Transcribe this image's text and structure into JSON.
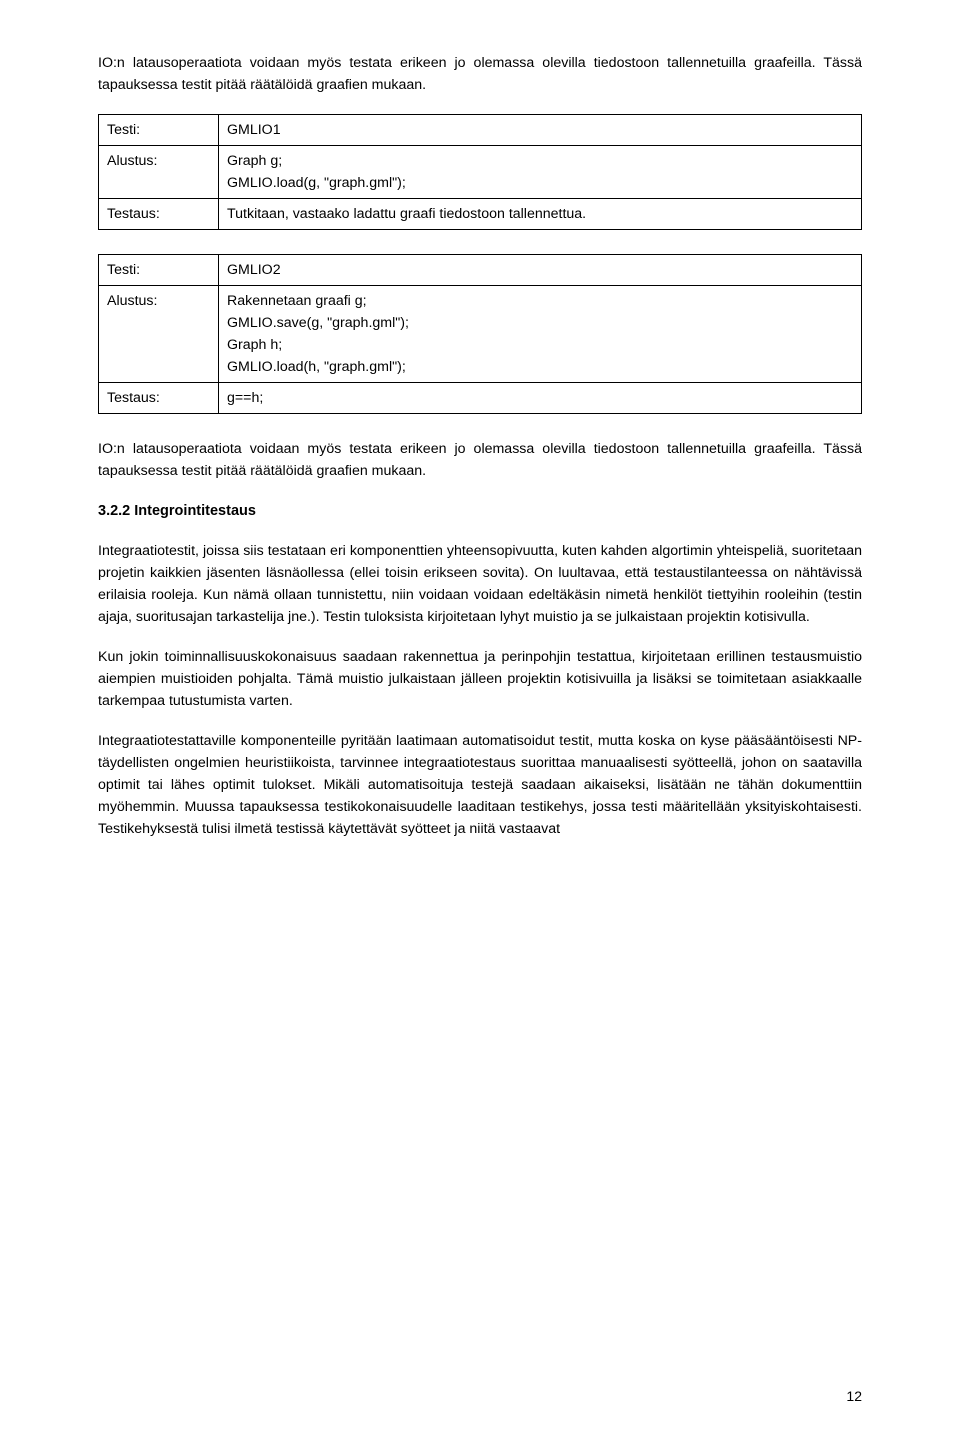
{
  "intro1": "IO:n latausoperaatiota voidaan myös testata erikeen jo olemassa olevilla tiedostoon tallennetuilla graafeilla. Tässä tapauksessa testit pitää räätälöidä graafien mukaan.",
  "table1": {
    "r1": {
      "label": "Testi:",
      "v1": "GMLIO1"
    },
    "r2": {
      "label": "Alustus:",
      "v1": "Graph g;",
      "v2": "GMLIO.load(g, \"graph.gml\");"
    },
    "r3": {
      "label": "Testaus:",
      "v1": "Tutkitaan, vastaako ladattu graafi tiedostoon tallennettua."
    }
  },
  "table2": {
    "r1": {
      "label": "Testi:",
      "v1": "GMLIO2"
    },
    "r2": {
      "label": "Alustus:",
      "v1": "Rakennetaan graafi g;",
      "v2": "GMLIO.save(g, \"graph.gml\");",
      "v3": "Graph h;",
      "v4": "GMLIO.load(h, \"graph.gml\");"
    },
    "r3": {
      "label": "Testaus:",
      "v1": "g==h;"
    }
  },
  "intro2": "IO:n latausoperaatiota voidaan myös testata erikeen jo olemassa olevilla tiedostoon tallennetuilla graafeilla. Tässä tapauksessa testit pitää räätälöidä graafien mukaan.",
  "heading": "3.2.2 Integrointitestaus",
  "p1": "Integraatiotestit, joissa siis testataan eri komponenttien yhteensopivuutta, kuten kahden algortimin yhteispeliä, suoritetaan projetin kaikkien jäsenten läsnäollessa (ellei toisin erikseen sovita). On luultavaa, että testaustilanteessa on nähtävissä erilaisia rooleja. Kun nämä ollaan tunnistettu, niin voidaan voidaan edeltäkäsin nimetä henkilöt tiettyihin rooleihin (testin ajaja, suoritusajan tarkastelija jne.). Testin tuloksista kirjoitetaan lyhyt muistio ja se julkaistaan projektin kotisivulla.",
  "p2": "Kun jokin toiminnallisuuskokonaisuus saadaan rakennettua ja perinpohjin testattua, kirjoitetaan erillinen testausmuistio aiempien muistioiden pohjalta. Tämä muistio julkaistaan jälleen projektin kotisivuilla ja lisäksi se toimitetaan asiakkaalle tarkempaa tutustumista varten.",
  "p3": "Integraatiotestattaville komponenteille pyritään laatimaan automatisoidut testit, mutta koska on kyse pääsääntöisesti NP-täydellisten ongelmien heuristiikoista, tarvinnee integraatiotestaus suorittaa manuaalisesti syötteellä, johon on saatavilla optimit tai lähes optimit tulokset. Mikäli automatisoituja testejä saadaan aikaiseksi, lisätään ne tähän dokumenttiin myöhemmin. Muussa tapauksessa testikokonaisuudelle laaditaan testikehys, jossa testi määritellään yksityiskohtaisesti. Testikehyksestä tulisi ilmetä testissä käytettävät syötteet ja niitä vastaavat",
  "page": "12"
}
